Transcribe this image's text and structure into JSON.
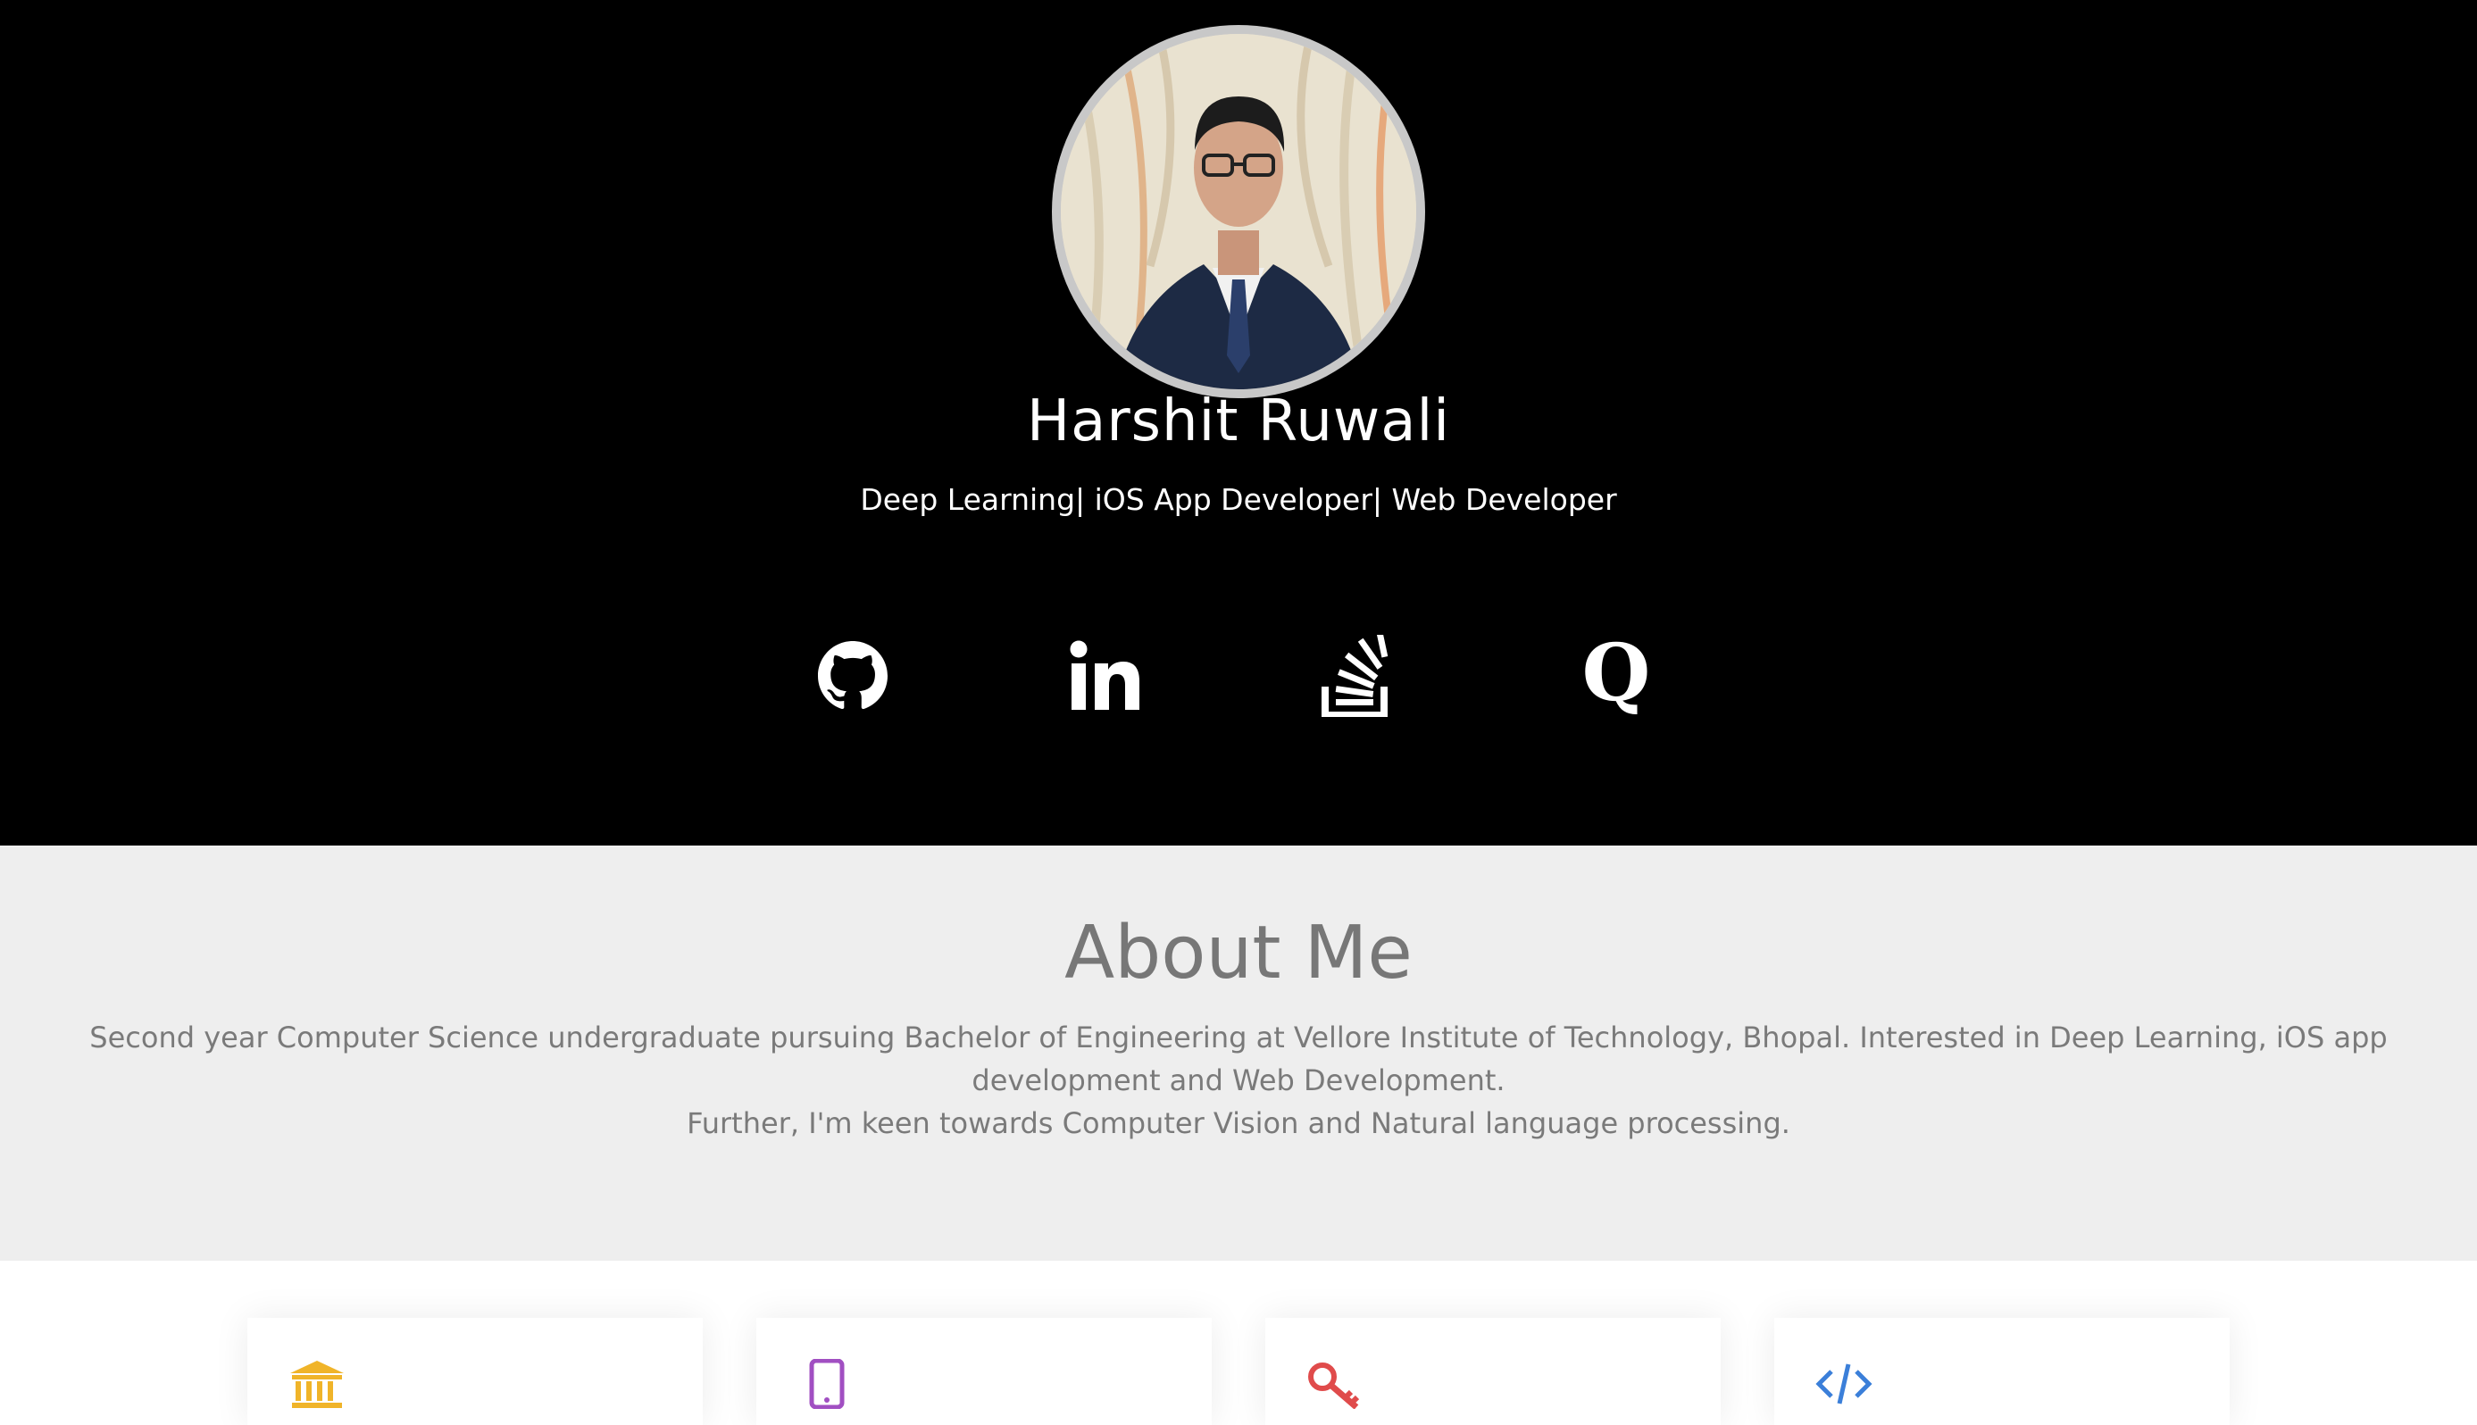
{
  "profile": {
    "name": "Harshit Ruwali",
    "tagline": "Deep Learning| iOS App Developer| Web Developer"
  },
  "social": [
    {
      "icon": "github-icon",
      "label": "GitHub"
    },
    {
      "icon": "linkedin-icon",
      "label": "LinkedIn"
    },
    {
      "icon": "stackoverflow-icon",
      "label": "Stack Overflow"
    },
    {
      "icon": "quora-icon",
      "label": "Quora"
    }
  ],
  "about": {
    "title": "About Me",
    "paragraph1": "Second year Computer Science undergraduate pursuing Bachelor of Engineering at Vellore Institute of Technology, Bhopal. Interested in Deep Learning, iOS app development and Web Development.",
    "paragraph2": "Further, I'm keen towards Computer Vision and Natural language processing."
  },
  "cards": [
    {
      "icon": "university-icon",
      "color": "#f0b429"
    },
    {
      "icon": "tablet-icon",
      "color": "#a14fc2"
    },
    {
      "icon": "key-icon",
      "color": "#e04b4b"
    },
    {
      "icon": "code-icon",
      "color": "#3b7fd9"
    }
  ],
  "colors": {
    "hero_bg": "#000000",
    "about_bg": "#eeeeee",
    "about_text": "#777777"
  }
}
